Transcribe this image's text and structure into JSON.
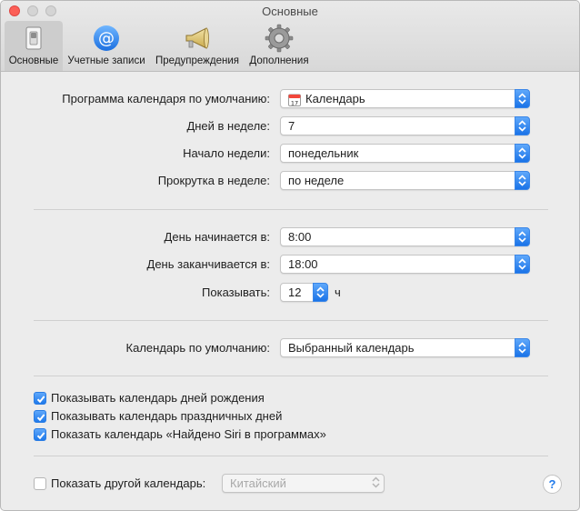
{
  "window": {
    "title": "Основные"
  },
  "tabs": [
    {
      "label": "Основные",
      "icon": "switch-icon"
    },
    {
      "label": "Учетные записи",
      "icon": "at-sign-icon"
    },
    {
      "label": "Предупреждения",
      "icon": "megaphone-icon"
    },
    {
      "label": "Дополнения",
      "icon": "gear-icon"
    }
  ],
  "general": {
    "default_app_label": "Программа календаря по умолчанию:",
    "default_app_value": "Календарь",
    "default_app_icon_day": "17",
    "days_label": "Дней в неделе:",
    "days_value": "7",
    "week_start_label": "Начало недели:",
    "week_start_value": "понедельник",
    "scroll_label": "Прокрутка в неделе:",
    "scroll_value": "по неделе"
  },
  "day": {
    "start_label": "День начинается в:",
    "start_value": "8:00",
    "end_label": "День заканчивается в:",
    "end_value": "18:00",
    "show_label": "Показывать:",
    "show_value": "12",
    "show_unit": "ч"
  },
  "default_calendar": {
    "label": "Календарь по умолчанию:",
    "value": "Выбранный календарь"
  },
  "checkboxes": [
    {
      "label": "Показывать календарь дней рождения",
      "checked": true
    },
    {
      "label": "Показывать календарь праздничных дней",
      "checked": true
    },
    {
      "label": "Показать календарь «Найдено Siri в программах»",
      "checked": true
    }
  ],
  "other_calendar": {
    "label": "Показать другой календарь:",
    "checked": false,
    "value": "Китайский"
  },
  "help": {
    "symbol": "?"
  },
  "colors": {
    "accent": "#1f79ea",
    "close": "#fc5f57"
  }
}
